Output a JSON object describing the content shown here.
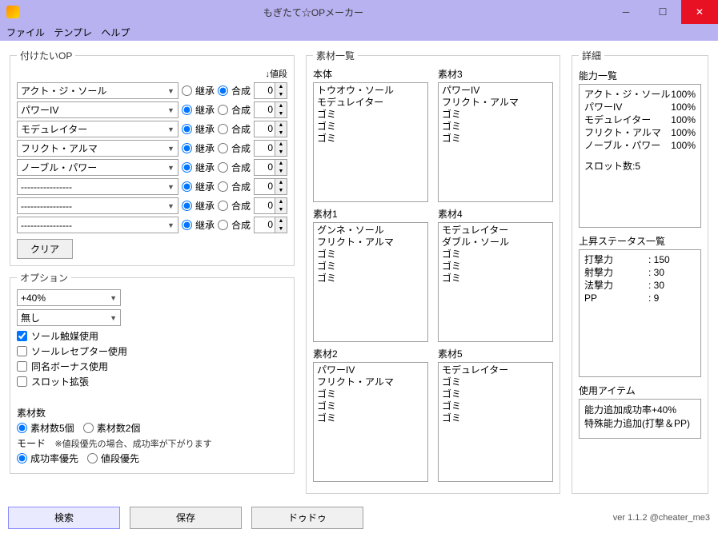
{
  "window": {
    "title": "もぎたて☆OPメーカー",
    "menu": {
      "file": "ファイル",
      "template": "テンプレ",
      "help": "ヘルプ"
    }
  },
  "ops": {
    "legend": "付けたいOP",
    "price_header": "↓値段",
    "inherit_label": "継承",
    "synth_label": "合成",
    "rows": [
      {
        "select": "アクト・ジ・ソール",
        "mode": "synth",
        "price": "0"
      },
      {
        "select": "パワーIV",
        "mode": "inherit",
        "price": "0"
      },
      {
        "select": "モデュレイター",
        "mode": "inherit",
        "price": "0"
      },
      {
        "select": "フリクト・アルマ",
        "mode": "inherit",
        "price": "0"
      },
      {
        "select": "ノーブル・パワー",
        "mode": "inherit",
        "price": "0"
      },
      {
        "select": "----------------",
        "mode": "inherit",
        "price": "0"
      },
      {
        "select": "----------------",
        "mode": "inherit",
        "price": "0"
      },
      {
        "select": "----------------",
        "mode": "inherit",
        "price": "0"
      }
    ],
    "clear": "クリア"
  },
  "option": {
    "legend": "オプション",
    "sel1": "+40%",
    "sel2": "無し",
    "checks": [
      {
        "label": "ソール触媒使用",
        "checked": true
      },
      {
        "label": "ソールレセプター使用",
        "checked": false
      },
      {
        "label": "同名ボーナス使用",
        "checked": false
      },
      {
        "label": "スロット拡張",
        "checked": false
      }
    ],
    "mat_count_label": "素材数",
    "mat_count_5": "素材数5個",
    "mat_count_2": "素材数2個",
    "mode_label": "モード",
    "mode_note": "※値段優先の場合、成功率が下がります",
    "mode_success": "成功率優先",
    "mode_price": "値段優先"
  },
  "materials": {
    "legend": "素材一覧",
    "boxes": [
      {
        "label": "本体",
        "items": [
          "トウオウ・ソール",
          "モデュレイター",
          "ゴミ",
          "ゴミ",
          "ゴミ"
        ]
      },
      {
        "label": "素材3",
        "items": [
          "パワーIV",
          "フリクト・アルマ",
          "ゴミ",
          "ゴミ",
          "ゴミ"
        ]
      },
      {
        "label": "素材1",
        "items": [
          "グンネ・ソール",
          "フリクト・アルマ",
          "ゴミ",
          "ゴミ",
          "ゴミ"
        ]
      },
      {
        "label": "素材4",
        "items": [
          "モデュレイター",
          "ダブル・ソール",
          "ゴミ",
          "ゴミ",
          "ゴミ"
        ]
      },
      {
        "label": "素材2",
        "items": [
          "パワーIV",
          "フリクト・アルマ",
          "ゴミ",
          "ゴミ",
          "ゴミ"
        ]
      },
      {
        "label": "素材5",
        "items": [
          "モデュレイター",
          "ゴミ",
          "ゴミ",
          "ゴミ",
          "ゴミ"
        ]
      }
    ]
  },
  "detail": {
    "legend": "詳細",
    "ability_label": "能力一覧",
    "abilities": [
      {
        "name": "アクト・ジ・ソール",
        "pct": "100%"
      },
      {
        "name": "パワーIV",
        "pct": "100%"
      },
      {
        "name": "モデュレイター",
        "pct": "100%"
      },
      {
        "name": "フリクト・アルマ",
        "pct": "100%"
      },
      {
        "name": "ノーブル・パワー",
        "pct": "100%"
      }
    ],
    "slot_label": "スロット数",
    "slot_value": "5",
    "status_label": "上昇ステータス一覧",
    "stats": [
      {
        "k": "打撃力",
        "v": ": 150"
      },
      {
        "k": "射撃力",
        "v": ": 30"
      },
      {
        "k": "法撃力",
        "v": ": 30"
      },
      {
        "k": "PP",
        "v": ": 9"
      }
    ],
    "item_label": "使用アイテム",
    "items": [
      "能力追加成功率+40%",
      "特殊能力追加(打撃＆PP)"
    ]
  },
  "buttons": {
    "search": "検索",
    "save": "保存",
    "dudu": "ドゥドゥ"
  },
  "version": "ver 1.1.2  @cheater_me3"
}
